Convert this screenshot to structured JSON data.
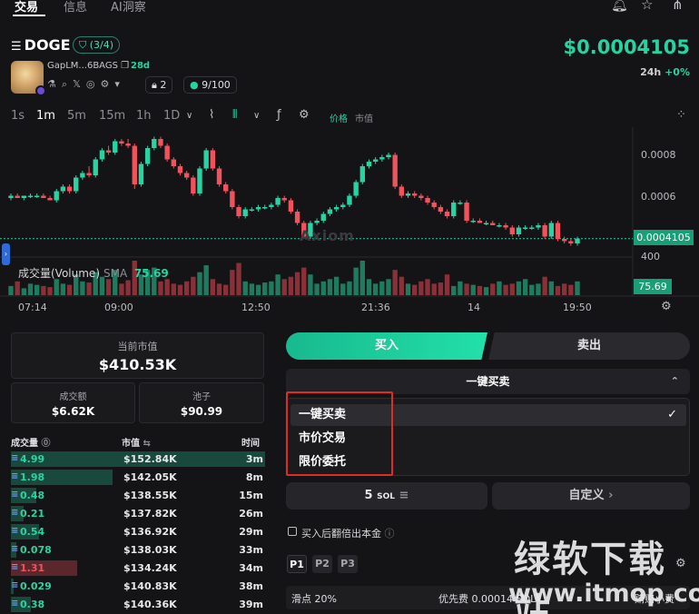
{
  "nav": {
    "tabs": [
      "交易",
      "信息",
      "AI洞察"
    ]
  },
  "token": {
    "symbol": "DOGE",
    "audit": "(3/4)",
    "address": "GapLM...6BAGS",
    "age": "28d",
    "holders": "2",
    "score": "9/100",
    "price": "$0.0004105",
    "change_period": "24h",
    "change_value": "+0%"
  },
  "toolbar": {
    "timeframes": [
      "1s",
      "1m",
      "5m",
      "15m",
      "1h",
      "1D"
    ],
    "active_timeframe": "1m",
    "price_label": "价格",
    "mcap_label": "市值"
  },
  "chart_data": {
    "type": "candlestick",
    "y_ticks": [
      "0.0008",
      "0.0006",
      "400"
    ],
    "last_price_label": "0.0004105",
    "volume_title": "成交量(Volume)",
    "volume_sma_label": "SMA",
    "volume_sma_value": "75.69",
    "x_labels": [
      "07:14",
      "09:00",
      "12:50",
      "21:36",
      "14",
      "19:50"
    ],
    "watermark": "Axiom",
    "ylim": [
      0.0004,
      0.00092
    ],
    "candles": [
      [
        0.00064,
        0.00066,
        0.00063,
        0.00065
      ],
      [
        0.00065,
        0.00066,
        0.00064,
        0.00064
      ],
      [
        0.00064,
        0.00065,
        0.00063,
        0.00065
      ],
      [
        0.00065,
        0.00066,
        0.00064,
        0.00065
      ],
      [
        0.00065,
        0.00066,
        0.00064,
        0.00065
      ],
      [
        0.00065,
        0.00066,
        0.00064,
        0.00064
      ],
      [
        0.00064,
        0.00065,
        0.00063,
        0.00063
      ],
      [
        0.00063,
        0.00068,
        0.00062,
        0.00067
      ],
      [
        0.00067,
        0.0007,
        0.00066,
        0.00069
      ],
      [
        0.00069,
        0.0007,
        0.00066,
        0.00067
      ],
      [
        0.00067,
        0.00074,
        0.00066,
        0.00073
      ],
      [
        0.00073,
        0.00076,
        0.00072,
        0.00075
      ],
      [
        0.00075,
        0.00078,
        0.00073,
        0.00074
      ],
      [
        0.00074,
        0.00082,
        0.00073,
        0.00081
      ],
      [
        0.00081,
        0.00086,
        0.0008,
        0.00085
      ],
      [
        0.00085,
        0.00087,
        0.00083,
        0.00084
      ],
      [
        0.00084,
        0.0009,
        0.00083,
        0.00089
      ],
      [
        0.00089,
        0.0009,
        0.00087,
        0.00088
      ],
      [
        0.00088,
        0.0009,
        0.00086,
        0.00087
      ],
      [
        0.00087,
        0.00088,
        0.00068,
        0.0007
      ],
      [
        0.0007,
        0.0008,
        0.00069,
        0.00079
      ],
      [
        0.00079,
        0.00087,
        0.00078,
        0.00086
      ],
      [
        0.00086,
        0.00091,
        0.00085,
        0.0009
      ],
      [
        0.0009,
        0.00091,
        0.00086,
        0.00087
      ],
      [
        0.00087,
        0.00088,
        0.0008,
        0.00081
      ],
      [
        0.00081,
        0.00082,
        0.00077,
        0.00078
      ],
      [
        0.00078,
        0.00079,
        0.00074,
        0.00075
      ],
      [
        0.00075,
        0.00076,
        0.00072,
        0.00073
      ],
      [
        0.00073,
        0.00074,
        0.00065,
        0.00066
      ],
      [
        0.00066,
        0.00078,
        0.00065,
        0.00077
      ],
      [
        0.00077,
        0.00086,
        0.00076,
        0.00085
      ],
      [
        0.00085,
        0.00086,
        0.00076,
        0.00077
      ],
      [
        0.00077,
        0.00078,
        0.00069,
        0.0007
      ],
      [
        0.0007,
        0.00071,
        0.00066,
        0.00067
      ],
      [
        0.00067,
        0.00068,
        0.00059,
        0.0006
      ],
      [
        0.0006,
        0.00061,
        0.00055,
        0.00056
      ],
      [
        0.00056,
        0.0006,
        0.00055,
        0.00059
      ],
      [
        0.00059,
        0.0006,
        0.00058,
        0.00059
      ],
      [
        0.00059,
        0.00061,
        0.00058,
        0.0006
      ],
      [
        0.0006,
        0.00061,
        0.00059,
        0.0006
      ],
      [
        0.0006,
        0.00062,
        0.00059,
        0.00061
      ],
      [
        0.00061,
        0.00065,
        0.0006,
        0.00064
      ],
      [
        0.00064,
        0.00065,
        0.00062,
        0.00063
      ],
      [
        0.00063,
        0.00064,
        0.00057,
        0.00058
      ],
      [
        0.00058,
        0.00059,
        0.00052,
        0.00053
      ],
      [
        0.00053,
        0.00054,
        0.00046,
        0.00047
      ],
      [
        0.00047,
        0.00054,
        0.00046,
        0.00053
      ],
      [
        0.00053,
        0.00055,
        0.00052,
        0.00054
      ],
      [
        0.00054,
        0.00058,
        0.00053,
        0.00057
      ],
      [
        0.00057,
        0.0006,
        0.00056,
        0.00059
      ],
      [
        0.00059,
        0.00061,
        0.00058,
        0.0006
      ],
      [
        0.0006,
        0.00062,
        0.00059,
        0.00061
      ],
      [
        0.00061,
        0.00066,
        0.0006,
        0.00065
      ],
      [
        0.00065,
        0.00072,
        0.00064,
        0.00071
      ],
      [
        0.00071,
        0.00079,
        0.0007,
        0.00078
      ],
      [
        0.00078,
        0.00081,
        0.00077,
        0.0008
      ],
      [
        0.0008,
        0.00082,
        0.00079,
        0.00081
      ],
      [
        0.00081,
        0.00083,
        0.0008,
        0.00082
      ],
      [
        0.00082,
        0.00084,
        0.00081,
        0.00083
      ],
      [
        0.00083,
        0.00084,
        0.00068,
        0.00069
      ],
      [
        0.00069,
        0.0007,
        0.00064,
        0.00065
      ],
      [
        0.00065,
        0.00067,
        0.00064,
        0.00066
      ],
      [
        0.00066,
        0.00067,
        0.00064,
        0.00065
      ],
      [
        0.00065,
        0.00066,
        0.00063,
        0.00064
      ],
      [
        0.00064,
        0.00065,
        0.00061,
        0.00062
      ],
      [
        0.00062,
        0.00063,
        0.00059,
        0.0006
      ],
      [
        0.0006,
        0.00061,
        0.00057,
        0.00058
      ],
      [
        0.00058,
        0.00059,
        0.00055,
        0.00056
      ],
      [
        0.00056,
        0.00063,
        0.00055,
        0.00062
      ],
      [
        0.00062,
        0.00063,
        0.00061,
        0.00062
      ],
      [
        0.00062,
        0.00063,
        0.00053,
        0.00054
      ],
      [
        0.00054,
        0.00055,
        0.00053,
        0.00054
      ],
      [
        0.00054,
        0.00055,
        0.00053,
        0.00053
      ],
      [
        0.00053,
        0.00054,
        0.00052,
        0.00053
      ],
      [
        0.00053,
        0.00054,
        0.00052,
        0.00052
      ],
      [
        0.00052,
        0.00053,
        0.00051,
        0.00052
      ],
      [
        0.00052,
        0.00053,
        0.0005,
        0.00051
      ],
      [
        0.00051,
        0.00052,
        0.00047,
        0.00048
      ],
      [
        0.00048,
        0.00052,
        0.00047,
        0.00051
      ],
      [
        0.00051,
        0.00052,
        0.0005,
        0.00051
      ],
      [
        0.00051,
        0.00052,
        0.0005,
        0.00051
      ],
      [
        0.00051,
        0.00053,
        0.0005,
        0.00052
      ],
      [
        0.00052,
        0.00053,
        0.00046,
        0.00047
      ],
      [
        0.00047,
        0.00054,
        0.00046,
        0.00053
      ],
      [
        0.00053,
        0.00054,
        0.00045,
        0.00046
      ],
      [
        0.00046,
        0.00047,
        0.00044,
        0.00045
      ],
      [
        0.00045,
        0.00046,
        0.00043,
        0.00044
      ],
      [
        0.00044,
        0.00047,
        0.00043,
        0.000461
      ]
    ],
    "volumes": [
      8,
      12,
      6,
      10,
      9,
      8,
      7,
      14,
      10,
      9,
      18,
      12,
      11,
      20,
      16,
      14,
      22,
      10,
      13,
      30,
      18,
      22,
      24,
      12,
      14,
      10,
      9,
      12,
      16,
      20,
      26,
      14,
      10,
      9,
      22,
      28,
      12,
      10,
      9,
      11,
      12,
      18,
      14,
      16,
      20,
      24,
      18,
      10,
      12,
      14,
      16,
      10,
      12,
      24,
      30,
      14,
      10,
      12,
      14,
      22,
      16,
      10,
      9,
      12,
      14,
      10,
      11,
      18,
      8,
      12,
      10,
      9,
      8,
      7,
      10,
      12,
      9,
      10,
      12,
      14,
      9,
      10,
      16,
      12,
      8,
      10,
      9,
      12
    ],
    "volume_colors": "alternating by candle direction"
  },
  "stats": {
    "mcap_title": "当前市值",
    "mcap_value": "$410.53K",
    "volume_title": "成交额",
    "volume_value": "$6.62K",
    "pool_title": "池子",
    "pool_value": "$90.99"
  },
  "trades": {
    "headers": [
      "成交量",
      "市值",
      "时间"
    ],
    "rows": [
      {
        "amount": "4.99",
        "mcap": "$152.84K",
        "time": "3m",
        "side": "buy",
        "fill": 1.0
      },
      {
        "amount": "1.98",
        "mcap": "$142.05K",
        "time": "8m",
        "side": "buy",
        "fill": 0.4
      },
      {
        "amount": "0.48",
        "mcap": "$138.55K",
        "time": "15m",
        "side": "buy",
        "fill": 0.1
      },
      {
        "amount": "0.21",
        "mcap": "$137.82K",
        "time": "26m",
        "side": "buy",
        "fill": 0.05
      },
      {
        "amount": "0.54",
        "mcap": "$136.92K",
        "time": "29m",
        "side": "buy",
        "fill": 0.11
      },
      {
        "amount": "0.078",
        "mcap": "$138.03K",
        "time": "33m",
        "side": "buy",
        "fill": 0.02
      },
      {
        "amount": "1.31",
        "mcap": "$134.24K",
        "time": "34m",
        "side": "sell",
        "fill": 0.26
      },
      {
        "amount": "0.029",
        "mcap": "$140.83K",
        "time": "38m",
        "side": "buy",
        "fill": 0.01
      },
      {
        "amount": "0.38",
        "mcap": "$140.36K",
        "time": "39m",
        "side": "buy",
        "fill": 0.08
      }
    ]
  },
  "order": {
    "buy_label": "买入",
    "sell_label": "卖出",
    "mode_selected": "一键买卖",
    "mode_options": [
      "一键买卖",
      "市价交易",
      "限价委托"
    ],
    "amount_label": "5",
    "amount_unit": "SOL",
    "custom_label": "自定义",
    "double_label": "买入后翻倍出本金",
    "presets": [
      "P1",
      "P2",
      "P3"
    ],
    "slippage": "滑点 20%",
    "priority_fee": "优先费 0.00014 SOL",
    "bribe": "贿赂小费"
  },
  "watermark": {
    "text": "绿软下载站",
    "url": "www.itmop.com"
  },
  "colors": {
    "up": "#29d3a1",
    "down": "#f0525e",
    "accent": "#1a9e78",
    "highlight": "#e02b2b"
  }
}
